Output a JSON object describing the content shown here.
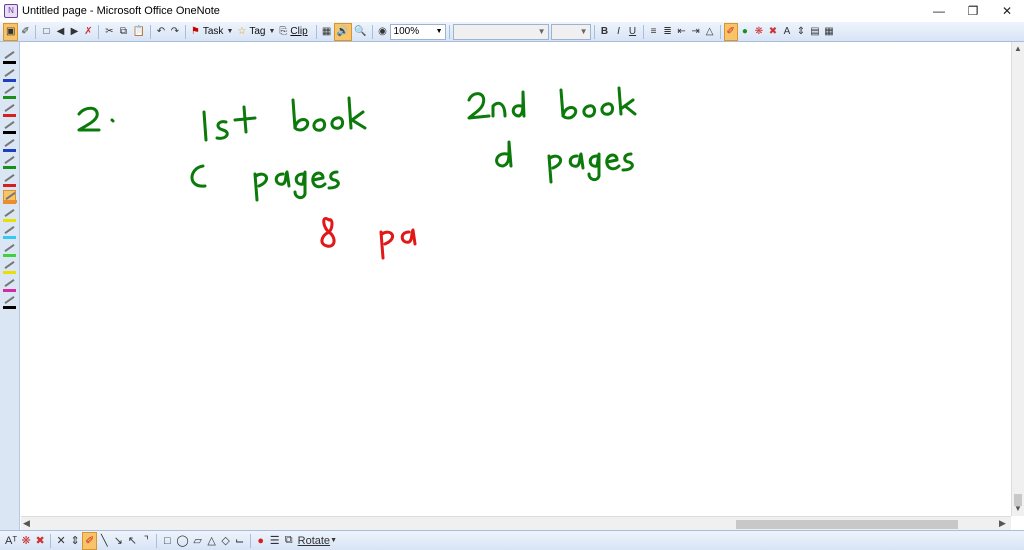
{
  "window": {
    "title": "Untitled page - Microsoft Office OneNote",
    "icon": "onenote-app-icon",
    "controls": [
      "minimize",
      "restore",
      "close"
    ]
  },
  "toolbar": {
    "task_label": "Task",
    "tag_label": "Tag",
    "clip_label": "Clip",
    "zoom_value": "100%",
    "font_name_value": "",
    "font_size_value": "",
    "bold_label": "B",
    "italic_label": "I",
    "underline_label": "U",
    "clear_format_label": "A",
    "icons": [
      "page-view-icon",
      "pen-icon",
      "new-page-icon",
      "back-icon",
      "forward-icon",
      "delete-icon",
      "cut-icon",
      "copy-icon",
      "paste-icon",
      "undo-icon",
      "redo-icon",
      "task-flag-icon",
      "tag-star-icon",
      "clip-icon",
      "fullpage-icon",
      "audio-icon",
      "research-icon",
      "help-icon",
      "bullets-icon",
      "numbering-icon",
      "outdent-icon",
      "indent-icon",
      "font-color-icon",
      "highlighter-icon",
      "pen-color-icon",
      "lasso-icon",
      "eraser-icon",
      "insert-space-icon",
      "page-setup-icon",
      "pen-mode-icon"
    ]
  },
  "pens": {
    "colors": [
      "#000000",
      "#1f3fbf",
      "#1a8f1a",
      "#d42020",
      "#000000",
      "#1f3fbf",
      "#1a8f1a",
      "#d42020",
      "#f28c28",
      "#e8e000",
      "#35c8f0",
      "#3fd13f",
      "#e8e000",
      "#d42aa8",
      "#000000"
    ],
    "selected_index": 8
  },
  "bottom": {
    "rotate_label": "Rotate",
    "icons": [
      "text-mode-icon",
      "lasso-select-icon",
      "eraser-icon",
      "delete-ink-icon",
      "insert-space-icon",
      "pen-icon",
      "line-icon",
      "arrow-icon",
      "double-arrow-icon",
      "connector-icon",
      "rectangle-icon",
      "ellipse-icon",
      "parallelogram-icon",
      "triangle-icon",
      "diamond-icon",
      "axis-icon",
      "color-icon",
      "line-weight-icon",
      "arrange-icon"
    ]
  },
  "ink": {
    "green": "#0b7a0b",
    "red": "#e01818"
  }
}
